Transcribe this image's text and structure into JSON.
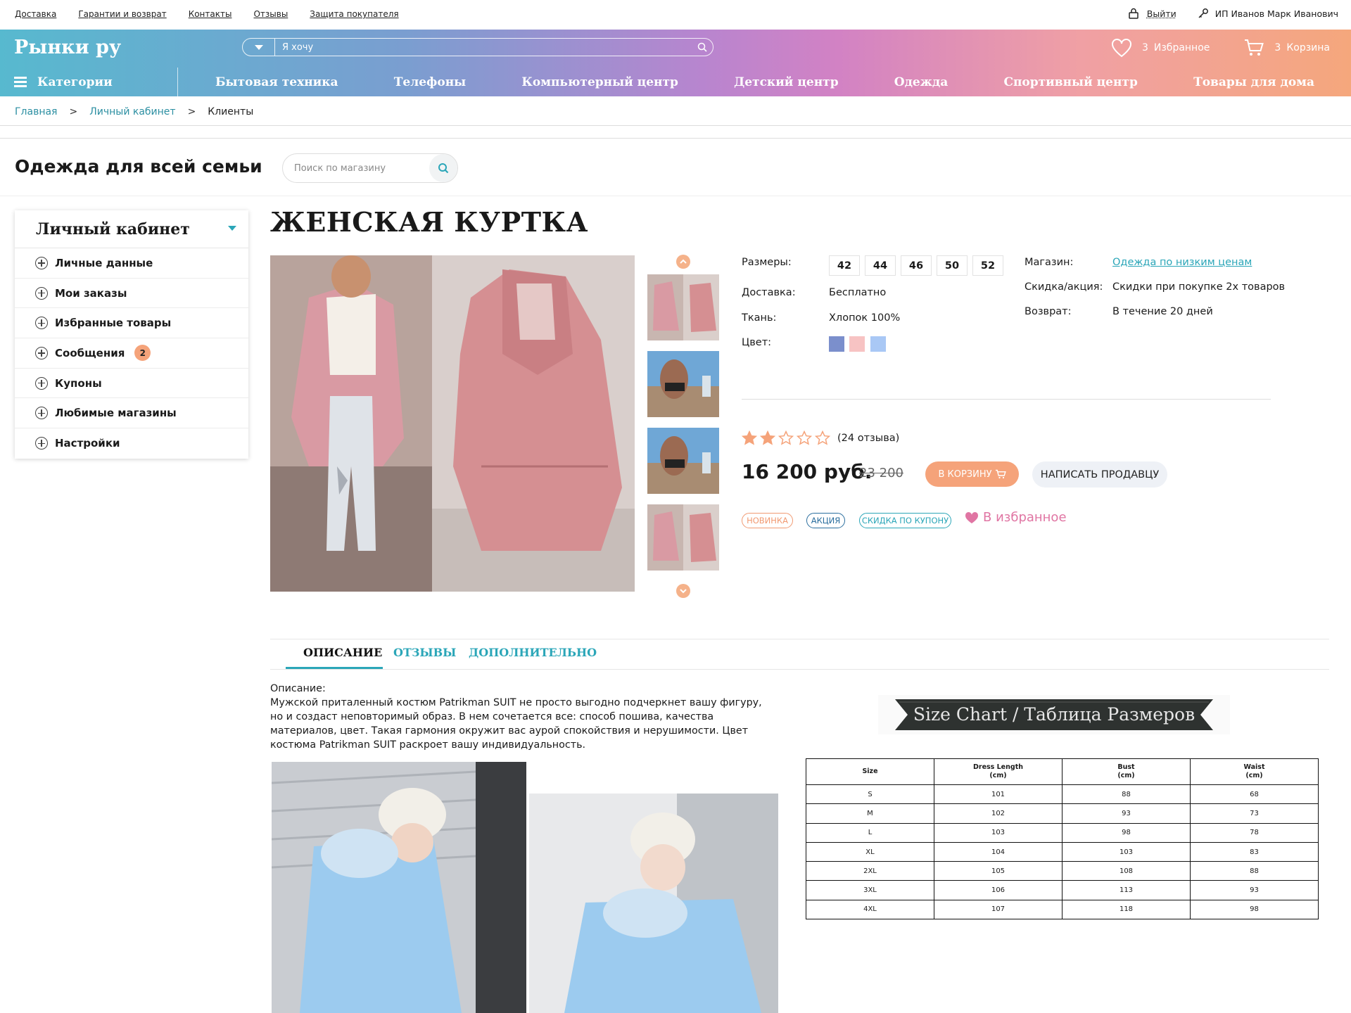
{
  "topbar": {
    "links": [
      "Доставка",
      "Гарантии и возврат",
      "Контакты",
      "Отзывы",
      "Защита покупателя"
    ],
    "logout": "Выйти",
    "user": "ИП Иванов Марк Иванович"
  },
  "header": {
    "logo": "Рынки ру",
    "search_placeholder": "Я хочу",
    "favorites_count": "3",
    "favorites_label": "Избранное",
    "cart_count": "3",
    "cart_label": "Корзина",
    "categories_label": "Категории",
    "nav": [
      "Бытовая техника",
      "Телефоны",
      "Компьютерный центр",
      "Детский центр",
      "Одежда",
      "Спортивный центр",
      "Товары для дома"
    ]
  },
  "breadcrumb": {
    "items": [
      "Главная",
      "Личный кабинет",
      "Клиенты"
    ],
    "separator": ">"
  },
  "shop": {
    "title": "Одежда для всей семьи",
    "search_placeholder": "Поиск по магазину"
  },
  "sidebar": {
    "title": "Личный кабинет",
    "items": [
      {
        "label": "Личные данные"
      },
      {
        "label": "Мои заказы"
      },
      {
        "label": "Избранные товары"
      },
      {
        "label": "Сообщения",
        "badge": "2"
      },
      {
        "label": "Купоны"
      },
      {
        "label": "Любимые магазины"
      },
      {
        "label": "Настройки"
      }
    ]
  },
  "product": {
    "title": "ЖЕНСКАЯ КУРТКА",
    "sizes_label": "Размеры:",
    "sizes": [
      "42",
      "44",
      "46",
      "50",
      "52"
    ],
    "delivery_label": "Доставка:",
    "delivery_value": "Бесплатно",
    "fabric_label": "Ткань:",
    "fabric_value": "Хлопок 100%",
    "color_label": "Цвет:",
    "colors": [
      "#7b8fcc",
      "#f7c3c3",
      "#a9c8f5"
    ],
    "shop_label": "Магазин:",
    "shop_value": "Одежда по низким ценам",
    "discount_label": "Скидка/акция:",
    "discount_value": "Скидки при покупке 2х товаров",
    "return_label": "Возврат:",
    "return_value": "В течение 20 дней",
    "rating": 2,
    "rating_max": 5,
    "reviews": "(24 отзыва)",
    "price": "16 200 руб.",
    "old_price": "23 200",
    "cart_button": "В КОРЗИНУ",
    "write_button": "НАПИСАТЬ ПРОДАВЦУ",
    "tags": [
      {
        "label": "НОВИНКА",
        "color": "#f19a72"
      },
      {
        "label": "АКЦИЯ",
        "color": "#2a6e9e"
      },
      {
        "label": "СКИДКА ПО КУПОНУ",
        "color": "#2ba6b8"
      }
    ],
    "favorite_link": "В избранное"
  },
  "tabs": [
    "ОПИСАНИЕ",
    "ОТЗЫВЫ",
    "ДОПОЛНИТЕЛЬНО"
  ],
  "description": {
    "heading": "Описание:",
    "text": "Мужской приталенный костюм Patrikman SUIT не просто выгодно подчеркнет вашу фигуру, но и создаст неповторимый образ. В нем сочетается все: способ пошива, качества материалов, цвет. Такая гармония окружит вас аурой спокойствия и нерушимости. Цвет костюма Patrikman SUIT раскроет вашу индивидуальность."
  },
  "size_chart": {
    "banner": "Size Chart / Таблица Размеров",
    "headers": [
      [
        "Size"
      ],
      [
        "Dress Length",
        "(cm)"
      ],
      [
        "Bust",
        "(cm)"
      ],
      [
        "Waist",
        "(cm)"
      ]
    ],
    "rows": [
      [
        "S",
        "101",
        "88",
        "68"
      ],
      [
        "M",
        "102",
        "93",
        "73"
      ],
      [
        "L",
        "103",
        "98",
        "78"
      ],
      [
        "XL",
        "104",
        "103",
        "83"
      ],
      [
        "2XL",
        "105",
        "108",
        "88"
      ],
      [
        "3XL",
        "106",
        "113",
        "93"
      ],
      [
        "4XL",
        "107",
        "118",
        "98"
      ]
    ]
  },
  "colors": {
    "accent": "#2ba6b8",
    "orange": "#f5a37a",
    "pink": "#e075a3"
  }
}
